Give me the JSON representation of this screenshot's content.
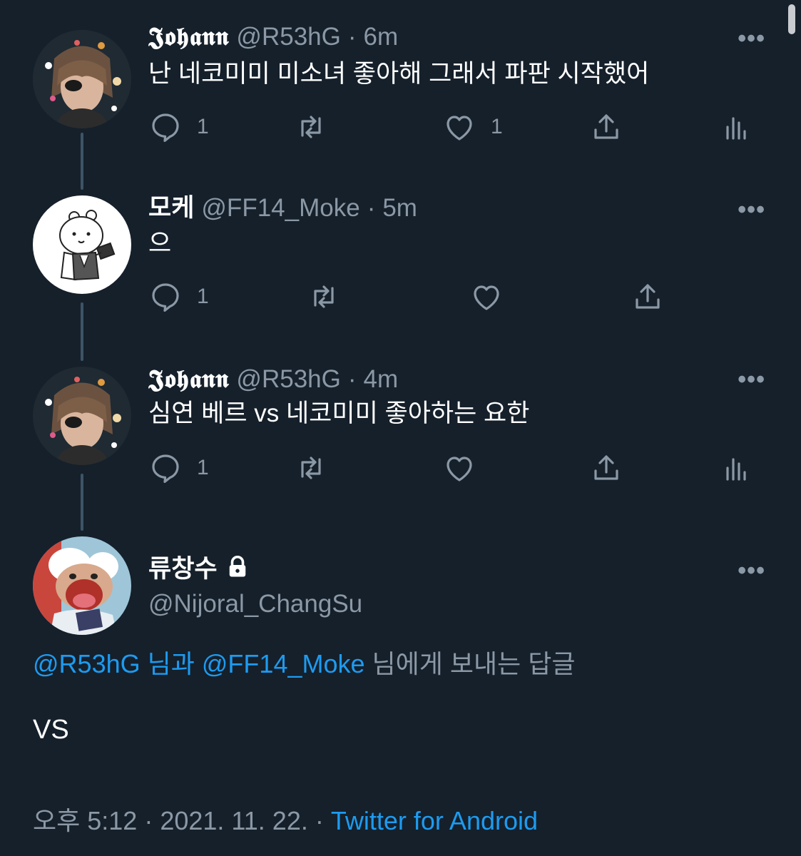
{
  "tweets": [
    {
      "display_name": "𝕵𝖔𝖍𝖆𝖓𝖓",
      "handle": "@R53hG",
      "separator": "·",
      "time": "6m",
      "text": "난 네코미미 미소녀 좋아해 그래서 파판 시작했어",
      "reply_count": "1",
      "like_count": "1",
      "more_label": "•••"
    },
    {
      "display_name": "모케",
      "handle": "@FF14_Moke",
      "separator": "·",
      "time": "5m",
      "text": "으",
      "reply_count": "1",
      "more_label": "•••"
    },
    {
      "display_name": "𝕵𝖔𝖍𝖆𝖓𝖓",
      "handle": "@R53hG",
      "separator": "·",
      "time": "4m",
      "text": "심연 베르 vs 네코미미 좋아하는 요한",
      "reply_count": "1",
      "more_label": "•••"
    }
  ],
  "main_tweet": {
    "display_name": "류창수",
    "handle": "@Nijoral_ChangSu",
    "more_label": "•••",
    "reply_to": {
      "mention1": "@R53hG",
      "conj1": "님과",
      "mention2": "@FF14_Moke",
      "conj2": "님에게 보내는 답글"
    },
    "text": "VS",
    "time": "오후 5:12",
    "separator": "·",
    "date": "2021. 11. 22.",
    "source": "Twitter for Android"
  },
  "colors": {
    "background": "#15202b",
    "secondary_text": "#8b98a5",
    "accent": "#1d9bf0",
    "thread_line": "#3d5466"
  },
  "icons": [
    "reply-icon",
    "retweet-icon",
    "like-icon",
    "share-icon",
    "analytics-icon",
    "lock-icon",
    "more-icon"
  ]
}
